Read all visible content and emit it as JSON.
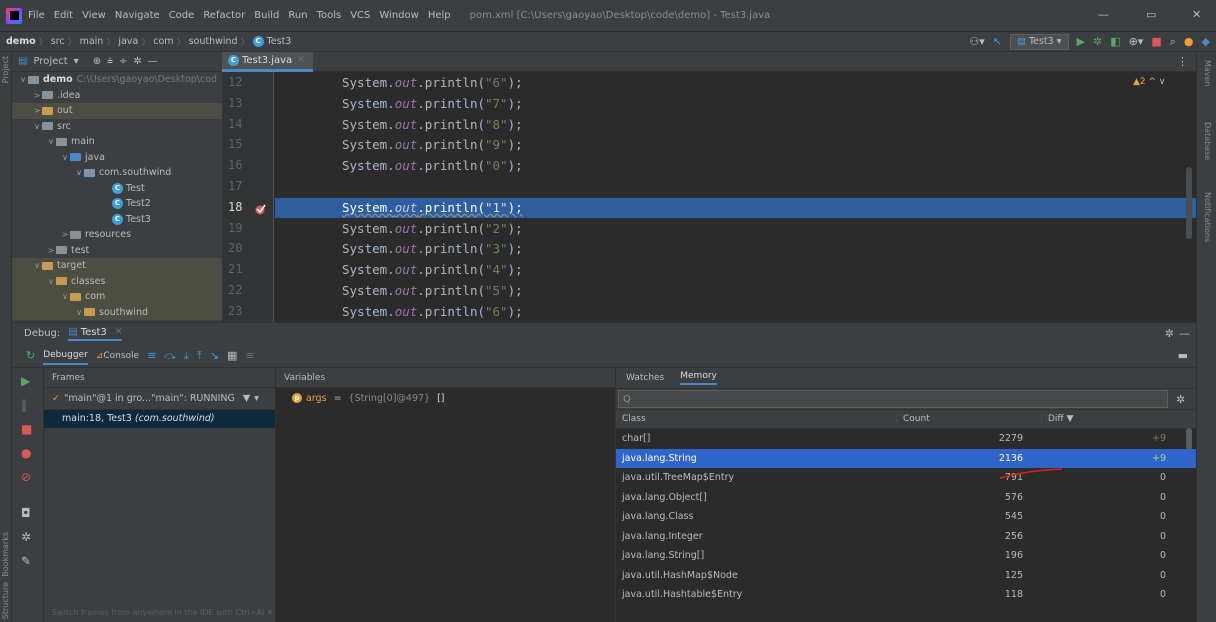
{
  "menubar": {
    "items": [
      "File",
      "Edit",
      "View",
      "Navigate",
      "Code",
      "Refactor",
      "Build",
      "Run",
      "Tools",
      "VCS",
      "Window",
      "Help"
    ],
    "window_title": "pom.xml [C:\\Users\\gaoyao\\Desktop\\code\\demo] - Test3.java",
    "controls": {
      "minimize": "—",
      "maximize": "▭",
      "close": "✕"
    }
  },
  "navbar": {
    "crumbs": [
      "demo",
      "src",
      "main",
      "java",
      "com",
      "southwind",
      "Test3"
    ],
    "run_config": "Test3"
  },
  "project": {
    "header": "Project",
    "tree": [
      {
        "label": "demo",
        "path": "C:\\Users\\gaoyao\\Desktop\\cod",
        "arrow": "∨",
        "indent": 0,
        "kind": "folder",
        "bold": true
      },
      {
        "label": ".idea",
        "arrow": ">",
        "indent": 1,
        "kind": "folder"
      },
      {
        "label": "out",
        "arrow": ">",
        "indent": 1,
        "kind": "folder yellow",
        "hl": true
      },
      {
        "label": "src",
        "arrow": "∨",
        "indent": 1,
        "kind": "folder"
      },
      {
        "label": "main",
        "arrow": "∨",
        "indent": 2,
        "kind": "folder"
      },
      {
        "label": "java",
        "arrow": "∨",
        "indent": 3,
        "kind": "folder blue"
      },
      {
        "label": "com.southwind",
        "arrow": "∨",
        "indent": 4,
        "kind": "folder pkg"
      },
      {
        "label": "Test",
        "arrow": "",
        "indent": 6,
        "kind": "class"
      },
      {
        "label": "Test2",
        "arrow": "",
        "indent": 6,
        "kind": "class"
      },
      {
        "label": "Test3",
        "arrow": "",
        "indent": 6,
        "kind": "class"
      },
      {
        "label": "resources",
        "arrow": ">",
        "indent": 3,
        "kind": "folder"
      },
      {
        "label": "test",
        "arrow": ">",
        "indent": 2,
        "kind": "folder"
      },
      {
        "label": "target",
        "arrow": "∨",
        "indent": 1,
        "kind": "folder yellow",
        "hl": true
      },
      {
        "label": "classes",
        "arrow": "∨",
        "indent": 2,
        "kind": "folder yellow",
        "hl": true
      },
      {
        "label": "com",
        "arrow": "∨",
        "indent": 3,
        "kind": "folder yellow",
        "hl": true
      },
      {
        "label": "southwind",
        "arrow": "∨",
        "indent": 4,
        "kind": "folder yellow",
        "hl": true
      }
    ]
  },
  "editor": {
    "tab": "Test3.java",
    "warnings": "▲2",
    "lines": [
      {
        "no": "12",
        "pre": "System.",
        "out": "out",
        "mid": ".println(",
        "str": "\"6\"",
        "post": ");"
      },
      {
        "no": "13",
        "pre": "System.",
        "out": "out",
        "mid": ".println(",
        "str": "\"7\"",
        "post": ");"
      },
      {
        "no": "14",
        "pre": "System.",
        "out": "out",
        "mid": ".println(",
        "str": "\"8\"",
        "post": ");"
      },
      {
        "no": "15",
        "pre": "System.",
        "out": "out",
        "mid": ".println(",
        "str": "\"9\"",
        "post": ");"
      },
      {
        "no": "16",
        "pre": "System.",
        "out": "out",
        "mid": ".println(",
        "str": "\"0\"",
        "post": ");"
      },
      {
        "no": "17",
        "pre": "",
        "out": "",
        "mid": "",
        "str": "",
        "post": ""
      },
      {
        "no": "18",
        "pre": "System.",
        "out": "out",
        "mid": ".println(",
        "str": "\"1\"",
        "post": ");",
        "exec": true
      },
      {
        "no": "19",
        "pre": "System.",
        "out": "out",
        "mid": ".println(",
        "str": "\"2\"",
        "post": ");"
      },
      {
        "no": "20",
        "pre": "System.",
        "out": "out",
        "mid": ".println(",
        "str": "\"3\"",
        "post": ");"
      },
      {
        "no": "21",
        "pre": "System.",
        "out": "out",
        "mid": ".println(",
        "str": "\"4\"",
        "post": ");"
      },
      {
        "no": "22",
        "pre": "System.",
        "out": "out",
        "mid": ".println(",
        "str": "\"5\"",
        "post": ");"
      },
      {
        "no": "23",
        "pre": "System.",
        "out": "out",
        "mid": ".println(",
        "str": "\"6\"",
        "post": ");"
      }
    ]
  },
  "debug": {
    "label": "Debug:",
    "session_tab": "Test3",
    "tabs": {
      "debugger": "Debugger",
      "console": "Console"
    },
    "frames_header": "Frames",
    "thread": "\"main\"@1 in gro...\"main\": RUNNING",
    "frame": {
      "location": "main:18, Test3",
      "package": "(com.southwind)"
    },
    "hint": "Switch frames from anywhere in the IDE with Ctrl+Al  ✕",
    "variables_header": "Variables",
    "variable": {
      "name": "args",
      "eq": " = ",
      "value": "{String[0]@497}",
      "arr": " []"
    }
  },
  "memory": {
    "tabs": {
      "watches": "Watches",
      "memory": "Memory"
    },
    "search_icon": "Q",
    "columns": {
      "class": "Class",
      "count": "Count",
      "diff": "Diff ▼"
    },
    "rows": [
      {
        "cls": "char[]",
        "count": "2279",
        "diff": "+9"
      },
      {
        "cls": "java.lang.String",
        "count": "2136",
        "diff": "+9",
        "selected": true
      },
      {
        "cls": "java.util.TreeMap$Entry",
        "count": "791",
        "diff": "0"
      },
      {
        "cls": "java.lang.Object[]",
        "count": "576",
        "diff": "0"
      },
      {
        "cls": "java.lang.Class",
        "count": "545",
        "diff": "0"
      },
      {
        "cls": "java.lang.Integer",
        "count": "256",
        "diff": "0"
      },
      {
        "cls": "java.lang.String[]",
        "count": "196",
        "diff": "0"
      },
      {
        "cls": "java.util.HashMap$Node",
        "count": "125",
        "diff": "0"
      },
      {
        "cls": "java.util.Hashtable$Entry",
        "count": "118",
        "diff": "0"
      }
    ]
  },
  "stripes": {
    "left": [
      "Project",
      "Bookmarks",
      "Structure"
    ],
    "right": [
      "Maven",
      "Database",
      "Notifications"
    ]
  },
  "colors": {
    "exec_line": "#2d5fa0",
    "selected_row": "#2f65ca",
    "breakpoint": "#e05555",
    "annotation": "#e02020"
  }
}
